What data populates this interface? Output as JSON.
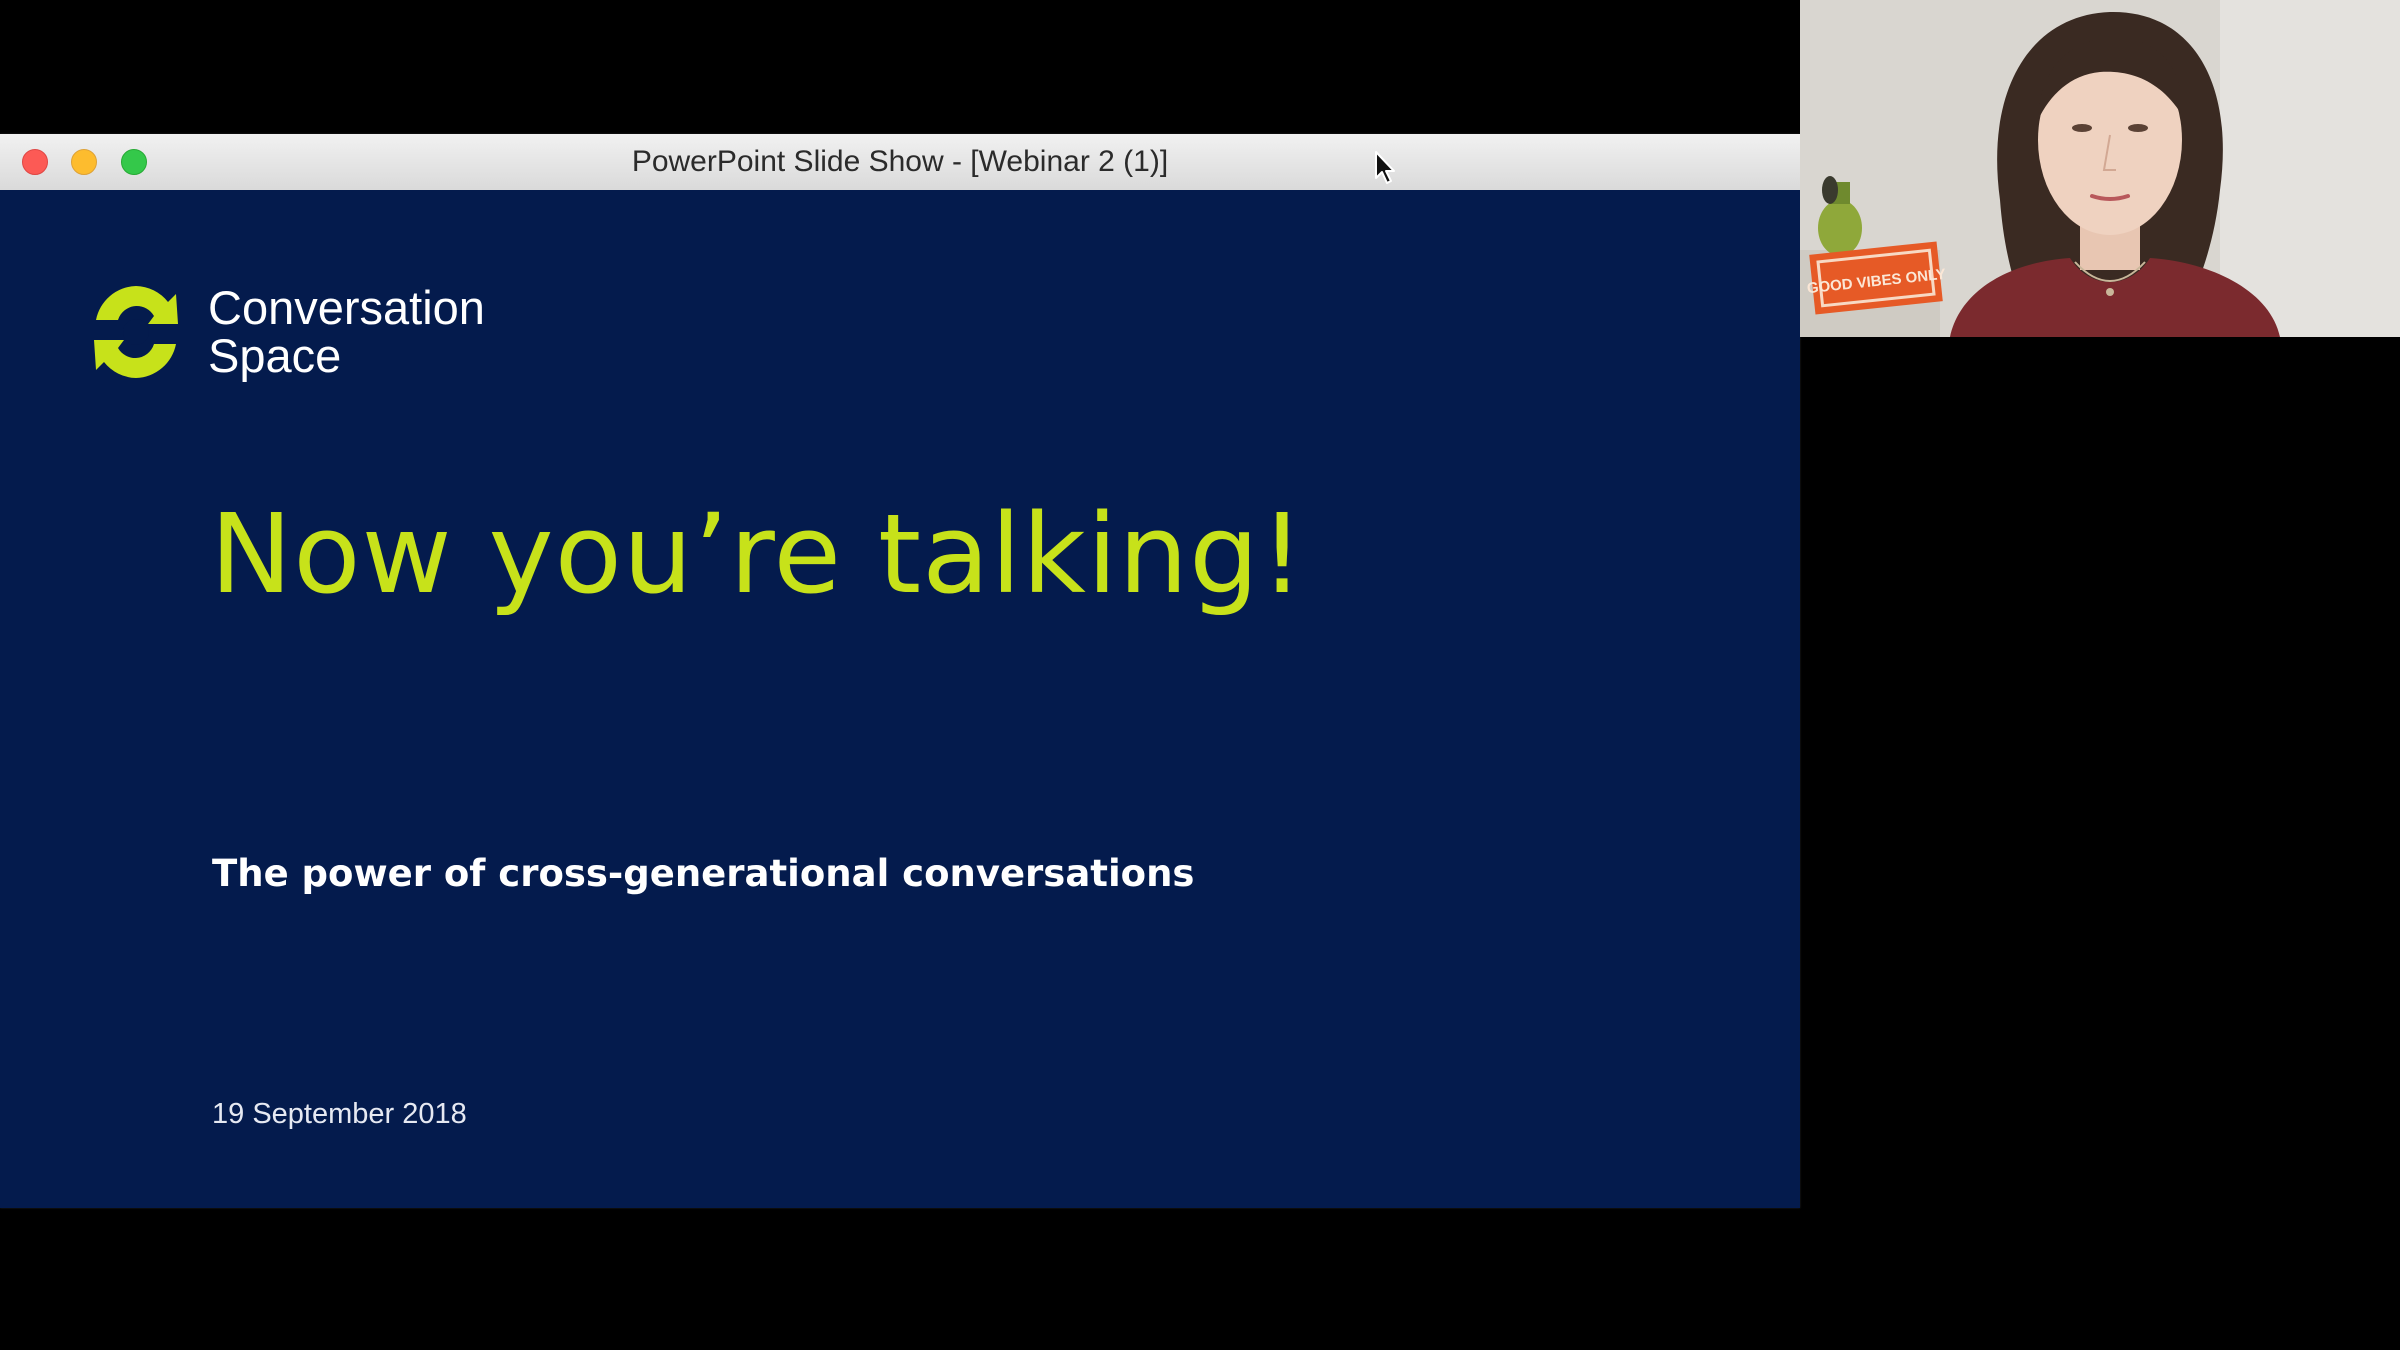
{
  "window": {
    "title": "PowerPoint Slide Show - [Webinar 2 (1)]"
  },
  "slide": {
    "brand_line1": "Conversation",
    "brand_line2": "Space",
    "title": "Now you’re talking!",
    "subtitle": "The power of cross-generational conversations",
    "date": "19 September 2018"
  },
  "webcam": {
    "sign_text": "GOOD VIBES ONLY"
  },
  "colors": {
    "slide_background": "#041b4d",
    "accent_green": "#c7e21a",
    "close_button": "#fc5a55",
    "minimize_button": "#fdbc2e",
    "maximize_button": "#34c84a"
  }
}
